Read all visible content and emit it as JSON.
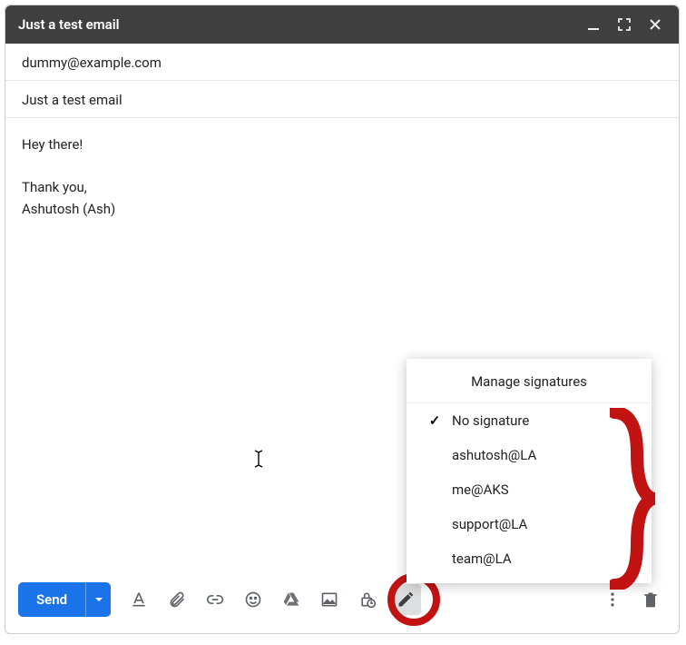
{
  "window": {
    "title": "Just a test email"
  },
  "fields": {
    "to": "dummy@example.com",
    "subject": "Just a test email"
  },
  "body": {
    "line1": "Hey there!",
    "line2": "Thank you,",
    "line3": "Ashutosh (Ash)"
  },
  "toolbar": {
    "send_label": "Send"
  },
  "signature_menu": {
    "header": "Manage signatures",
    "items": [
      {
        "label": "No signature",
        "selected": true
      },
      {
        "label": "ashutosh@LA",
        "selected": false
      },
      {
        "label": "me@AKS",
        "selected": false
      },
      {
        "label": "support@LA",
        "selected": false
      },
      {
        "label": "team@LA",
        "selected": false
      }
    ]
  },
  "annotation": {
    "color": "#c21313"
  }
}
